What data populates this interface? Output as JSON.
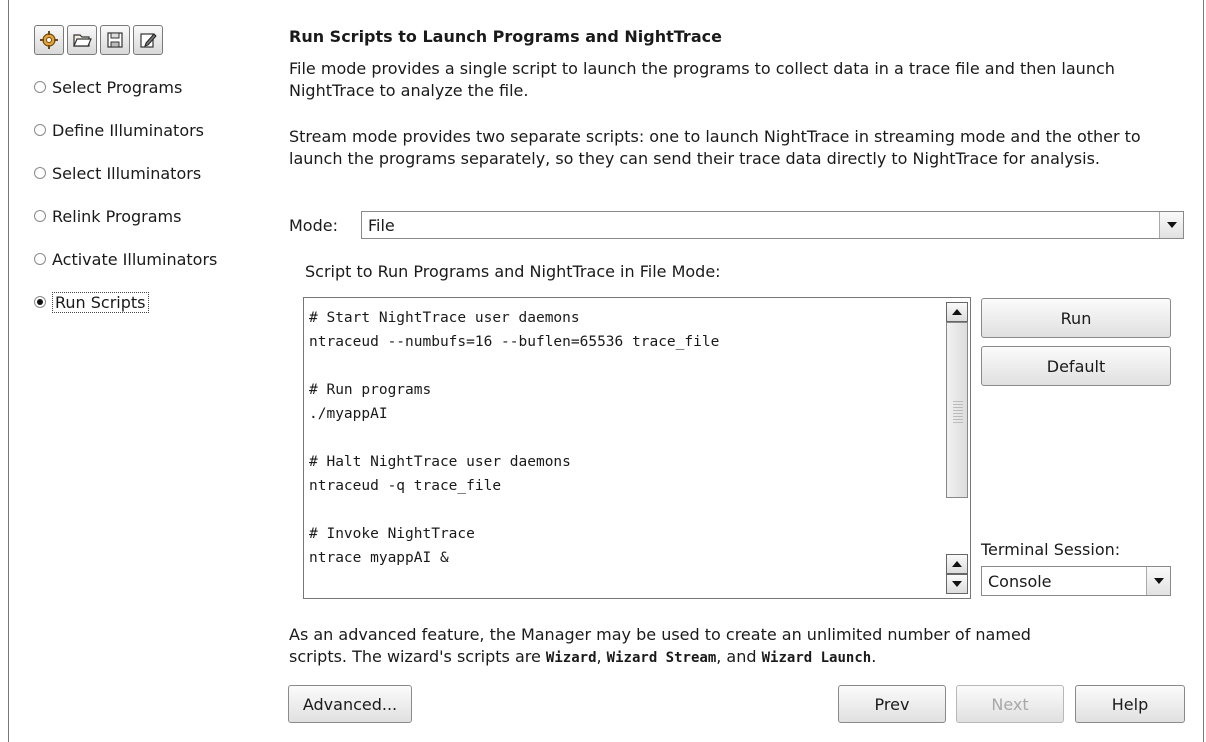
{
  "toolbar": {
    "icons": [
      "settings-icon",
      "open-folder-icon",
      "save-icon",
      "edit-icon"
    ]
  },
  "steps": [
    {
      "label": "Select Programs",
      "selected": false
    },
    {
      "label": "Define Illuminators",
      "selected": false
    },
    {
      "label": "Select Illuminators",
      "selected": false
    },
    {
      "label": "Relink Programs",
      "selected": false
    },
    {
      "label": "Activate Illuminators",
      "selected": false
    },
    {
      "label": "Run Scripts",
      "selected": true
    }
  ],
  "main": {
    "title": "Run Scripts to Launch Programs and NightTrace",
    "file_mode_desc": "File mode provides a single script to launch the programs to collect data in a trace file and then launch NightTrace to analyze the file.",
    "stream_mode_desc": "Stream mode provides two separate scripts: one to launch NightTrace in streaming mode and the other to launch the programs separately, so they can send their trace data directly to NightTrace for analysis.",
    "mode_label": "Mode:",
    "mode_value": "File",
    "script_label": "Script to Run Programs and NightTrace in File Mode:",
    "script_lines": [
      "# Start NightTrace user daemons",
      "ntraceud --numbufs=16 --buflen=65536 trace_file",
      "",
      "# Run programs",
      "./myappAI",
      "",
      "# Halt NightTrace user daemons",
      "ntraceud -q trace_file",
      "",
      "# Invoke NightTrace",
      "ntrace myappAI &"
    ],
    "run_label": "Run",
    "default_label": "Default",
    "terminal_label": "Terminal Session:",
    "terminal_value": "Console",
    "advanced_text_1": "As an advanced feature, the Manager may be used to create an unlimited number of named",
    "advanced_text_2a": "scripts. The wizard's scripts are ",
    "script_name_1": "Wizard",
    "sep_1": ", ",
    "script_name_2": "Wizard Stream",
    "sep_2": ", and ",
    "script_name_3": "Wizard Launch",
    "end_dot": "."
  },
  "footer": {
    "advanced_label": "Advanced...",
    "prev_label": "Prev",
    "next_label": "Next",
    "help_label": "Help"
  },
  "colors": {
    "border": "#777777",
    "disabled_text": "#a8a8a8"
  }
}
